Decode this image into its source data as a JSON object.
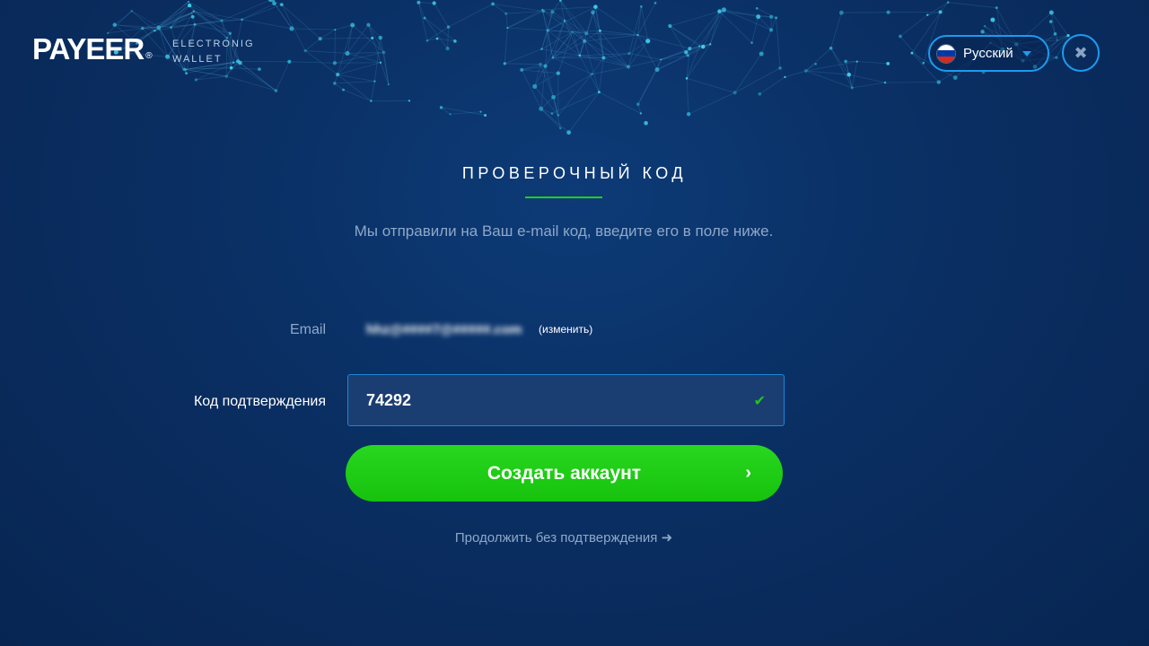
{
  "header": {
    "logo_text": "PAYEER",
    "logo_mark": "®",
    "tagline_line1": "ELECTRONIG",
    "tagline_line2": "WALLET",
    "language": {
      "label": "Русский",
      "flag_colors": [
        "#ffffff",
        "#0039a6",
        "#d52b1e"
      ]
    },
    "close_icon": "✖"
  },
  "main": {
    "title": "ПРОВЕРОЧНЫЙ КОД",
    "description": "Мы отправили на Ваш e-mail код, введите его в поле ниже.",
    "email": {
      "label": "Email",
      "value": "hhz@####7@#####.com",
      "change_link": "(изменить)"
    },
    "code": {
      "label": "Код подтверждения",
      "value": "74292"
    },
    "submit": {
      "label": "Создать аккаунт",
      "arrow_icon": "›"
    },
    "skip_link": "Продолжить без подтверждения ➜"
  },
  "colors": {
    "accent_blue": "#1c9bf0",
    "accent_green": "#1fcf1c",
    "background": "#0a2f63"
  }
}
